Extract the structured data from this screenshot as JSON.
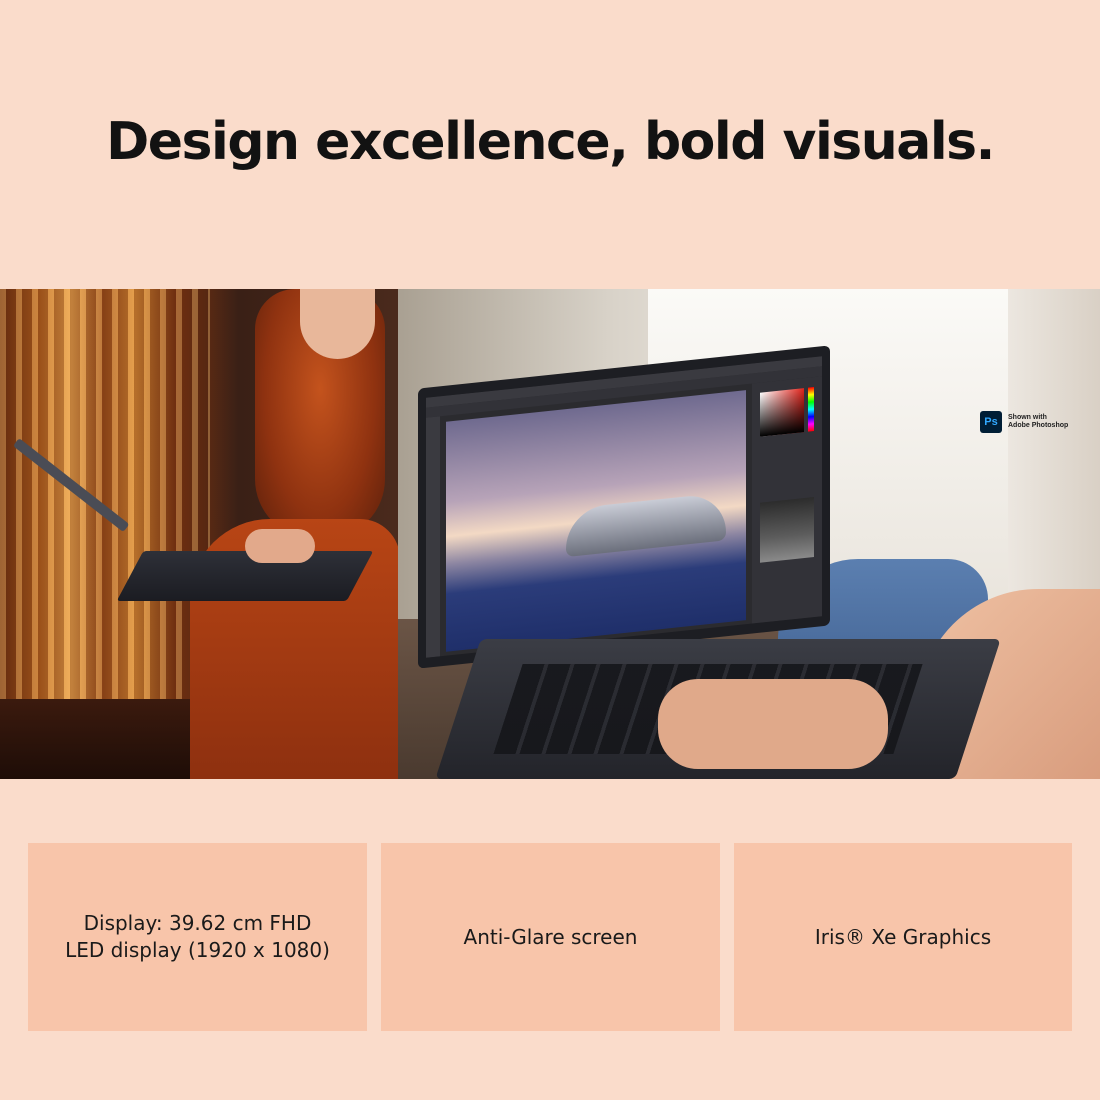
{
  "headline": "Design excellence, bold visuals.",
  "photoshop_badge": {
    "logo_text": "Ps",
    "line1": "Shown with",
    "line2": "Adobe Photoshop"
  },
  "features": [
    {
      "line1": "Display: 39.62 cm FHD",
      "line2": "LED display (1920 x 1080)"
    },
    {
      "line1": "Anti-Glare screen",
      "line2": ""
    },
    {
      "line1": "Iris® Xe Graphics",
      "line2": ""
    }
  ],
  "colors": {
    "background": "#fadccb",
    "card": "#f8c5aa",
    "text": "#121212",
    "ps_logo_bg": "#001e36",
    "ps_logo_fg": "#31a8ff"
  }
}
